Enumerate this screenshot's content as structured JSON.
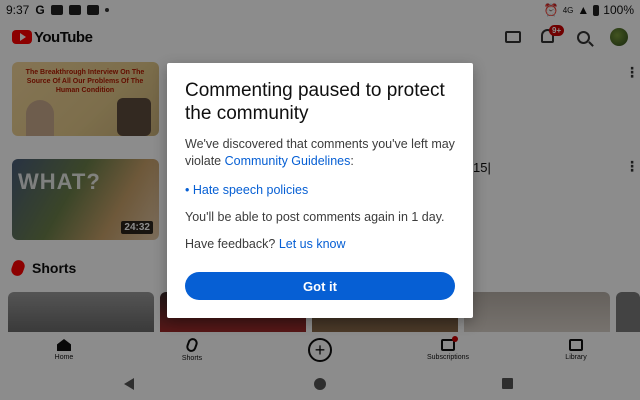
{
  "status_bar": {
    "time": "9:37",
    "g_icon": "G",
    "battery": "100%",
    "network": "4G"
  },
  "app": {
    "logo_text": "YouTube",
    "notifications_badge": "9+"
  },
  "feed": {
    "video1": {
      "thumbnail_text": "The Breakthrough Interview On The Source Of All Our Problems Of The Human Condition"
    },
    "video2": {
      "thumbnail_text": "WHAT?",
      "duration": "24:32"
    },
    "partial_text": "15|"
  },
  "shorts": {
    "title": "Shorts"
  },
  "bottom_nav": {
    "home": "Home",
    "shorts": "Shorts",
    "create": "+",
    "subscriptions": "Subscriptions",
    "library": "Library"
  },
  "dialog": {
    "title": "Commenting paused to protect the community",
    "body_text": "We've discovered that comments you've left may violate ",
    "body_link": "Community Guidelines",
    "body_end": ":",
    "policy_link": "• Hate speech policies",
    "resume_text": "You'll be able to post comments again in 1 day.",
    "feedback_text": "Have feedback? ",
    "feedback_link": "Let us know",
    "button_label": "Got it"
  },
  "colors": {
    "brand_red": "#ff0000",
    "link_blue": "#065fd4",
    "button_blue": "#065fd4"
  }
}
